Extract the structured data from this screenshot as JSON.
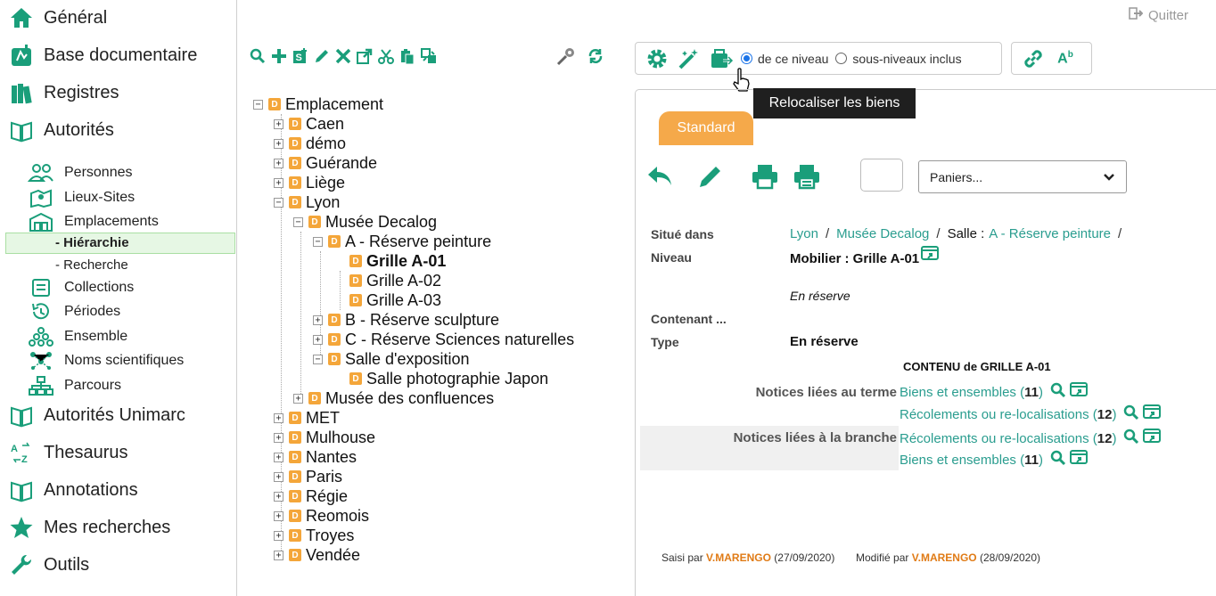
{
  "sidebar": {
    "general": "Général",
    "base_doc": "Base documentaire",
    "registres": "Registres",
    "autorites": "Autorités",
    "personnes": "Personnes",
    "lieux_sites": "Lieux-Sites",
    "emplacements": "Emplacements",
    "hierarchie": "- Hiérarchie",
    "recherche": "- Recherche",
    "collections": "Collections",
    "periodes": "Périodes",
    "ensemble": "Ensemble",
    "noms_scientifiques": "Noms scientifiques",
    "parcours": "Parcours",
    "autorites_unimarc": "Autorités Unimarc",
    "thesaurus": "Thesaurus",
    "annotations": "Annotations",
    "mes_recherches": "Mes recherches",
    "outils": "Outils"
  },
  "tree": {
    "root": "Emplacement",
    "caen": "Caen",
    "demo": "démo",
    "guerande": "Guérande",
    "liege": "Liège",
    "lyon": "Lyon",
    "musee_decalog": "Musée Decalog",
    "a_reserve": "A - Réserve peinture",
    "grille_a01": "Grille A-01",
    "grille_a02": "Grille A-02",
    "grille_a03": "Grille A-03",
    "b_reserve": "B - Réserve sculpture",
    "c_reserve": "C - Réserve Sciences naturelles",
    "salle_expo": "Salle d'exposition",
    "salle_photo": "Salle photographie Japon",
    "musee_confluences": "Musée des confluences",
    "met": "MET",
    "mulhouse": "Mulhouse",
    "nantes": "Nantes",
    "paris": "Paris",
    "regie": "Régie",
    "reomois": "Reomois",
    "troyes": "Troyes",
    "vendee": "Vendée",
    "badge": "D"
  },
  "header": {
    "quit": "Quitter",
    "radio_level": "de ce niveau",
    "radio_sub": "sous-niveaux inclus",
    "tooltip": "Relocaliser les biens",
    "ab_label": "A",
    "ab_sup": "b"
  },
  "content": {
    "tab": "Standard",
    "paniers": "Paniers...",
    "situe_label": "Situé dans",
    "crumb_lyon": "Lyon",
    "crumb_musee": "Musée Decalog",
    "crumb_salle_prefix": "Salle :",
    "crumb_salle": "A - Réserve peinture",
    "slash": "/",
    "niveau_label": "Niveau",
    "niveau_bold": "Mobilier",
    "niveau_value": ": Grille A-01",
    "en_reserve_italic": "En réserve",
    "contenant_label": "Contenant ...",
    "type_label": "Type",
    "type_value": "En réserve",
    "contenu_title": "CONTENU de GRILLE A-01",
    "notices_terme": "Notices liées au terme",
    "notices_branche": "Notices liées à la branche",
    "biens_ensembles": "Biens et ensembles",
    "recolements": "Récolements ou re-localisations",
    "paren_open": "(",
    "paren_close": ")",
    "count_biens_terme": "11",
    "count_recol_terme": "12",
    "count_recol_branche": "12",
    "count_biens_branche": "11",
    "saisi_par": "Saisi par",
    "saisi_user": "V.MARENGO",
    "saisi_date": "(27/09/2020)",
    "modifie_par": "Modifié par",
    "modifie_user": "V.MARENGO",
    "modifie_date": "(28/09/2020)"
  },
  "colors": {
    "accent_green": "#1a9e7a",
    "tab_orange": "#f5a94a",
    "link_teal": "#2a9d8f",
    "badge_orange": "#f4a63a"
  }
}
